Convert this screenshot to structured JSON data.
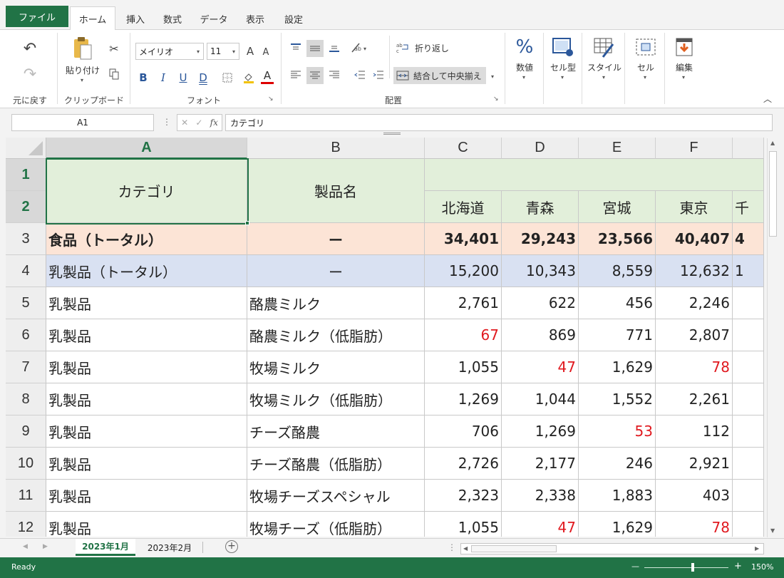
{
  "tabs": {
    "file": "ファイル",
    "items": [
      "ホーム",
      "挿入",
      "数式",
      "データ",
      "表示",
      "設定"
    ]
  },
  "ribbon": {
    "undo_group": "元に戻す",
    "clipboard": {
      "paste": "貼り付け",
      "label": "クリップボード"
    },
    "font": {
      "name": "メイリオ",
      "size": "11",
      "label": "フォント",
      "bold": "B",
      "italic": "I",
      "underline": "U",
      "double_underline": "D",
      "grow": "A",
      "shrink": "A",
      "color": "A"
    },
    "alignment": {
      "wrap": "折り返し",
      "merge": "結合して中央揃え",
      "label": "配置"
    },
    "number": {
      "symbol": "%",
      "label": "数値"
    },
    "cell_style": "セル型",
    "style": "スタイル",
    "cells": "セル",
    "edit": "編集"
  },
  "formula_bar": {
    "name_box": "A1",
    "content": "カテゴリ",
    "fx": "fx",
    "cancel": "✕",
    "confirm": "✓"
  },
  "columns": [
    "A",
    "B",
    "C",
    "D",
    "E",
    "F"
  ],
  "rows": [
    "1",
    "2",
    "3",
    "4",
    "5",
    "6",
    "7",
    "8",
    "9",
    "10",
    "11",
    "12"
  ],
  "header": {
    "category": "カテゴリ",
    "product": "製品名",
    "regions": [
      "北海道",
      "青森",
      "宮城",
      "東京",
      "千"
    ]
  },
  "table": [
    {
      "category": "食品（トータル）",
      "product": "ー",
      "values": [
        "34,401",
        "29,243",
        "23,566",
        "40,407",
        "4"
      ]
    },
    {
      "category": "乳製品（トータル）",
      "product": "ー",
      "values": [
        "15,200",
        "10,343",
        "8,559",
        "12,632",
        "1"
      ]
    },
    {
      "category": "乳製品",
      "product": "酪農ミルク",
      "values": [
        "2,761",
        "622",
        "456",
        "2,246"
      ]
    },
    {
      "category": "乳製品",
      "product": "酪農ミルク（低脂肪）",
      "values": [
        "67",
        "869",
        "771",
        "2,807"
      ]
    },
    {
      "category": "乳製品",
      "product": "牧場ミルク",
      "values": [
        "1,055",
        "47",
        "1,629",
        "78"
      ]
    },
    {
      "category": "乳製品",
      "product": "牧場ミルク（低脂肪）",
      "values": [
        "1,269",
        "1,044",
        "1,552",
        "2,261"
      ]
    },
    {
      "category": "乳製品",
      "product": "チーズ酪農",
      "values": [
        "706",
        "1,269",
        "53",
        "112"
      ]
    },
    {
      "category": "乳製品",
      "product": "チーズ酪農（低脂肪）",
      "values": [
        "2,726",
        "2,177",
        "246",
        "2,921"
      ]
    },
    {
      "category": "乳製品",
      "product": "牧場チーズスペシャル",
      "values": [
        "2,323",
        "2,338",
        "1,883",
        "403"
      ]
    },
    {
      "category": "乳製品",
      "product": "牧場チーズ（低脂肪）",
      "values": [
        "1,055",
        "47",
        "1,629",
        "78"
      ]
    }
  ],
  "sheets": [
    "2023年1月",
    "2023年2月"
  ],
  "status": {
    "text": "Ready",
    "zoom": "150%",
    "minus": "—",
    "plus": "+"
  },
  "colors": {
    "accent": "#217346",
    "negative": "#e0191f",
    "header_fill": "#e2efda",
    "food_fill": "#fce4d6",
    "dairy_fill": "#d9e1f2"
  }
}
